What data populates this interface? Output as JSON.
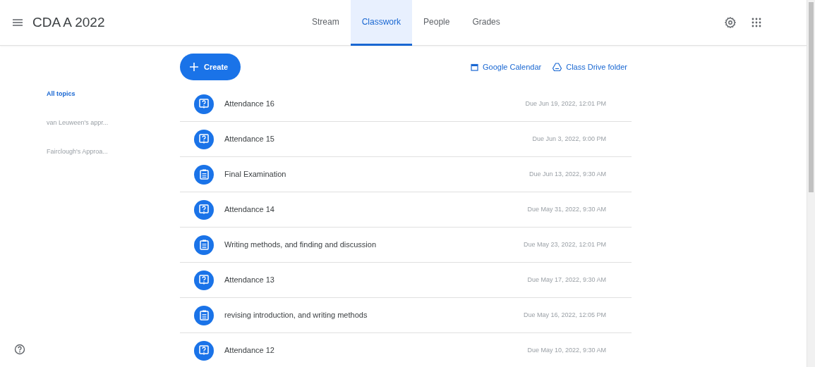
{
  "header": {
    "title": "CDA A 2022"
  },
  "tabs": [
    {
      "label": "Stream",
      "selected": false
    },
    {
      "label": "Classwork",
      "selected": true
    },
    {
      "label": "People",
      "selected": false
    },
    {
      "label": "Grades",
      "selected": false
    }
  ],
  "toolbar": {
    "create": "Create",
    "links": [
      "Google Calendar",
      "Class Drive folder"
    ]
  },
  "topics": [
    {
      "label": "All topics",
      "selected": true
    },
    {
      "label": "van Leuween's appr...",
      "selected": false
    },
    {
      "label": "Fairclough's Approa...",
      "selected": false
    }
  ],
  "items": [
    {
      "kind": "question",
      "title": "Attendance 16",
      "due": "Due Jun 19, 2022, 12:01 PM"
    },
    {
      "kind": "question",
      "title": "Attendance 15",
      "due": "Due Jun 3, 2022, 9:00 PM"
    },
    {
      "kind": "assignment",
      "title": "Final Examination",
      "due": "Due Jun 13, 2022, 9:30 AM"
    },
    {
      "kind": "question",
      "title": "Attendance 14",
      "due": "Due May 31, 2022, 9:30 AM"
    },
    {
      "kind": "assignment",
      "title": "Writing methods, and finding and discussion",
      "due": "Due May 23, 2022, 12:01 PM"
    },
    {
      "kind": "question",
      "title": "Attendance 13",
      "due": "Due May 17, 2022, 9:30 AM"
    },
    {
      "kind": "assignment",
      "title": "revising introduction, and writing methods",
      "due": "Due May 16, 2022, 12:05 PM"
    },
    {
      "kind": "question",
      "title": "Attendance 12",
      "due": "Due May 10, 2022, 9:30 AM"
    }
  ]
}
